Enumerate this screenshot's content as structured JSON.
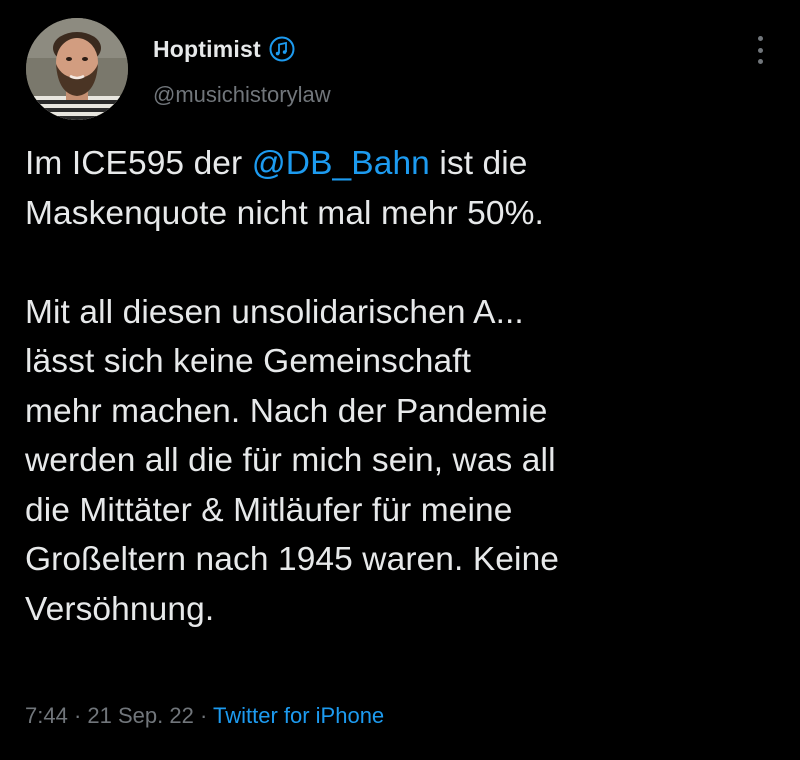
{
  "user": {
    "display_name": "Hoptimist",
    "badge_icon": "music-note-icon",
    "handle": "@musichistorylaw"
  },
  "menu": {
    "icon": "more-vertical-icon"
  },
  "tweet": {
    "line1_prefix": "Im ICE595 der ",
    "mention": "@DB_Bahn",
    "line1_suffix": " ist die",
    "line2": "Maskenquote nicht mal mehr 50%.",
    "paragraph2_lines": [
      "Mit all diesen unsolidarischen A...",
      "lässt sich keine Gemeinschaft",
      "mehr machen. Nach der Pandemie",
      "werden all die für mich sein, was all",
      "die Mittäter & Mitläufer für meine",
      "Großeltern nach 1945 waren. Keine",
      "Versöhnung."
    ]
  },
  "meta": {
    "time": "7:44",
    "separator": " · ",
    "date": "21 Sep. 22",
    "source": "Twitter for iPhone"
  },
  "colors": {
    "background": "#000000",
    "text": "#e7e9ea",
    "secondary": "#71767b",
    "accent": "#1d9bf0"
  }
}
